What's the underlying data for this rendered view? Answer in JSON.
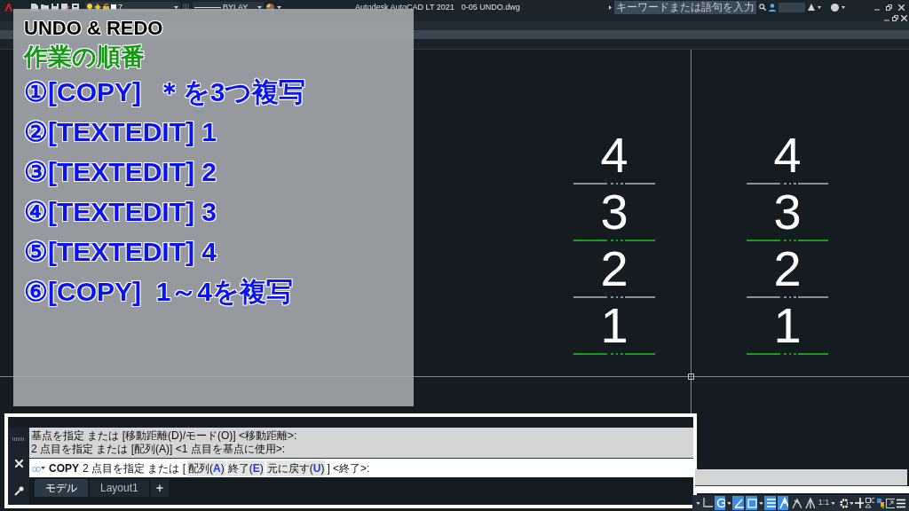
{
  "title_bar": {
    "layer": "7",
    "linetype": "BYLAY...",
    "title": "Autodesk AutoCAD LT 2021",
    "file": "0-05 UNDO.dwg",
    "search": {
      "placeholder": "キーワードまたは語句を入力"
    }
  },
  "overlay": {
    "title": "UNDO & REDO",
    "subtitle": "作業の順番",
    "steps": [
      "①[COPY]  ＊を3つ複写",
      "②[TEXTEDIT] 1",
      "③[TEXTEDIT] 2",
      "④[TEXTEDIT] 3",
      "⑤[TEXTEDIT] 4",
      "⑥[COPY]  1～4を複写"
    ]
  },
  "drawing": {
    "columns": [
      {
        "labels": [
          {
            "text": "4",
            "color": "#8a9096"
          },
          {
            "text": "3",
            "color": "#1f9a1f"
          },
          {
            "text": "2",
            "color": "#8a9096"
          },
          {
            "text": "1",
            "color": "#1f9a1f"
          }
        ]
      },
      {
        "labels": [
          {
            "text": "4",
            "color": "#8a9096"
          },
          {
            "text": "3",
            "color": "#1f9a1f"
          },
          {
            "text": "2",
            "color": "#8a9096"
          },
          {
            "text": "1",
            "color": "#1f9a1f"
          }
        ]
      }
    ]
  },
  "command": {
    "history": [
      "基点を指定 または [移動距離(D)/モード(O)] <移動距離>:",
      "2 点目を指定 または [配列(A)] <1 点目を基点に使用>:"
    ],
    "prompt": {
      "command": "COPY",
      "text": "2 点目を指定 または [",
      "options": [
        {
          "label": "配列(",
          "key": "A",
          "end": ")"
        },
        {
          "label": "終了(",
          "key": "E",
          "end": ")"
        },
        {
          "label": "元に戻す(",
          "key": "U",
          "end": ")"
        }
      ],
      "end": "] <終了>:"
    }
  },
  "layout_tabs": [
    {
      "label": "モデル",
      "selected": true
    },
    {
      "label": "Layout1",
      "selected": false
    }
  ],
  "add_tab": "+",
  "status_bar": {
    "toggles": [
      {
        "kind": "ucs",
        "on": false
      },
      {
        "kind": "polar",
        "on": true
      },
      {
        "kind": "angle",
        "on": true
      },
      {
        "kind": "osnap",
        "on": true
      },
      {
        "kind": "lineweight",
        "on": true
      },
      {
        "kind": "annotation",
        "on": true
      },
      {
        "kind": "annoscale",
        "on": false
      },
      {
        "kind": "annovisible",
        "on": false
      }
    ],
    "scale": "1:1"
  }
}
